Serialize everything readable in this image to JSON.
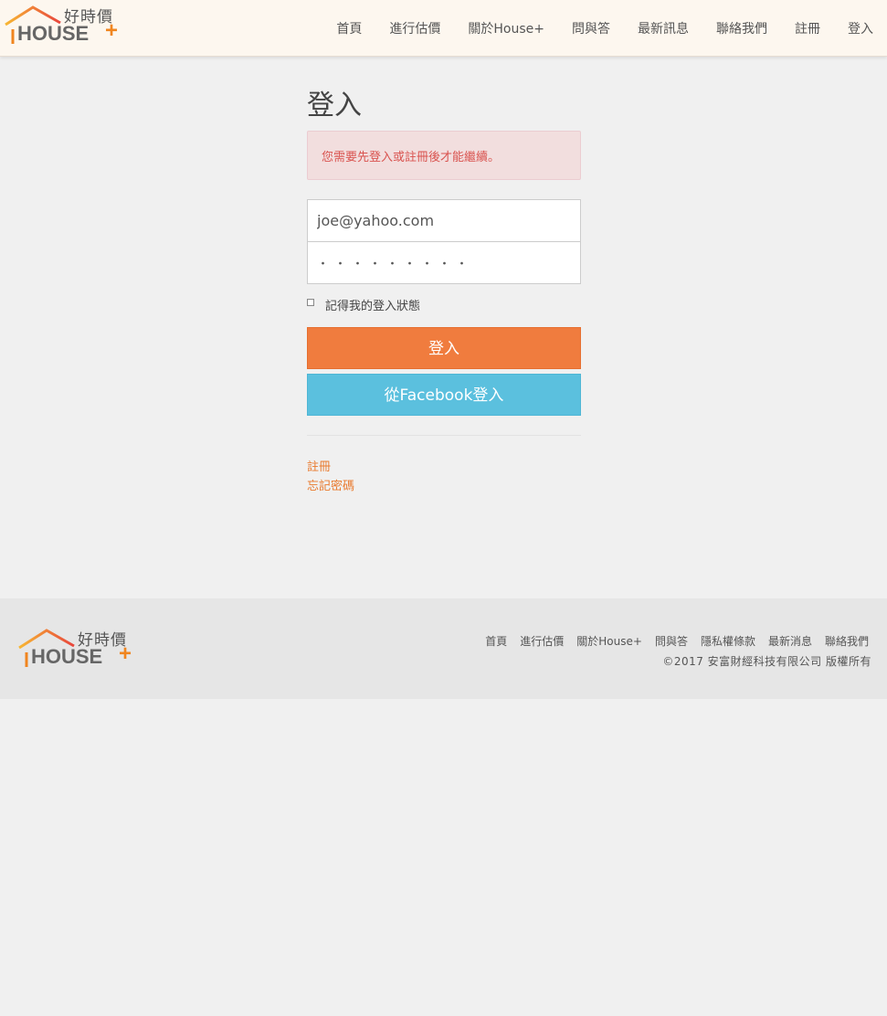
{
  "header": {
    "logo": {
      "cn": "好時價",
      "en": "HOUSE",
      "plus": "+"
    },
    "nav": [
      {
        "label": "首頁"
      },
      {
        "label": "進行估價"
      },
      {
        "label": "關於House+"
      },
      {
        "label": "問與答"
      },
      {
        "label": "最新訊息"
      },
      {
        "label": "聯絡我們"
      },
      {
        "label": "註冊"
      },
      {
        "label": "登入"
      }
    ]
  },
  "login": {
    "title": "登入",
    "alert": "您需要先登入或註冊後才能繼續。",
    "email_value": "joe@yahoo.com",
    "password_mask": "・・・・・・・・・",
    "remember_label": "記得我的登入狀態",
    "login_button": "登入",
    "facebook_button": "從Facebook登入",
    "register_link": "註冊",
    "forgot_link": "忘記密碼"
  },
  "footer": {
    "logo": {
      "cn": "好時價",
      "en": "HOUSE",
      "plus": "+"
    },
    "links": [
      {
        "label": "首頁"
      },
      {
        "label": "進行估價"
      },
      {
        "label": "關於House+"
      },
      {
        "label": "問與答"
      },
      {
        "label": "隱私權條款"
      },
      {
        "label": "最新消息"
      },
      {
        "label": "聯絡我們"
      }
    ],
    "copyright": "©2017 安富財經科技有限公司 版權所有"
  },
  "colors": {
    "accent_orange": "#f07c3e",
    "facebook_blue": "#5bc0de",
    "alert_bg": "#f2dede",
    "alert_text": "#d9534f",
    "link_orange": "#e97a2e"
  }
}
